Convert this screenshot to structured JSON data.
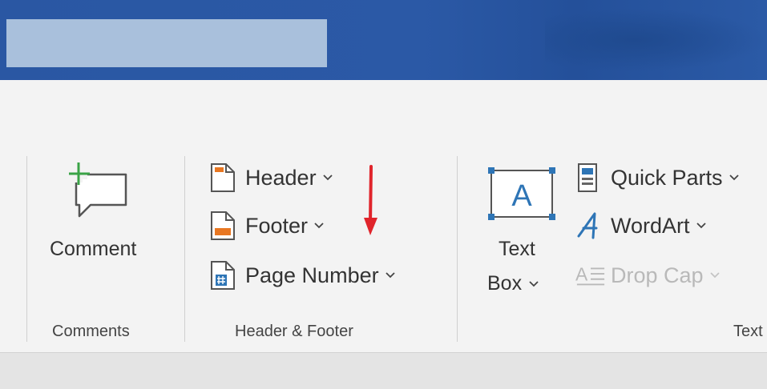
{
  "ribbon": {
    "groups": {
      "comments": {
        "label": "Comments",
        "comment_button": "Comment"
      },
      "header_footer": {
        "label": "Header & Footer",
        "header": "Header",
        "footer": "Footer",
        "page_number": "Page Number"
      },
      "text": {
        "label": "Text",
        "text_box_line1": "Text",
        "text_box_line2": "Box",
        "text_box_glyph": "A",
        "quick_parts": "Quick Parts",
        "wordart": "WordArt",
        "drop_cap": "Drop Cap"
      }
    }
  },
  "colors": {
    "title_bar": "#2b59a6",
    "accent_blue": "#2e75b6",
    "annotation_arrow": "#e0242b",
    "comment_plus": "#3aa346"
  }
}
